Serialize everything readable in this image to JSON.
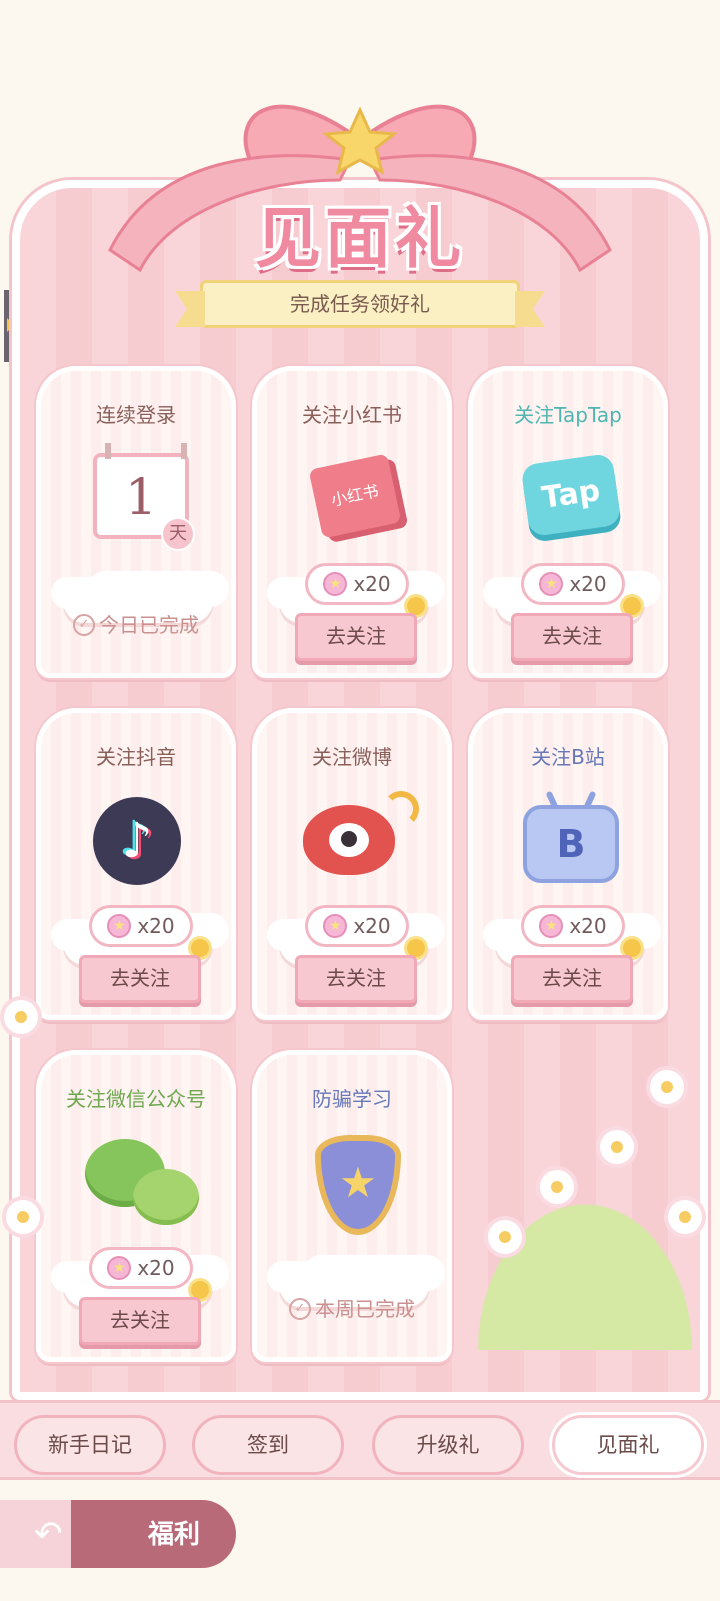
{
  "header": {
    "title": "见面礼",
    "subtitle": "完成任务领好礼"
  },
  "cards": [
    {
      "title": "连续登录",
      "calendar_number": "1",
      "calendar_unit": "天",
      "status": "今日已完成"
    },
    {
      "title": "关注小红书",
      "icon_text": "小红书",
      "reward": "x20",
      "button": "去关注"
    },
    {
      "title": "关注TapTap",
      "icon_text": "Tap",
      "reward": "x20",
      "button": "去关注"
    },
    {
      "title": "关注抖音",
      "icon_text": "♪",
      "reward": "x20",
      "button": "去关注"
    },
    {
      "title": "关注微博",
      "reward": "x20",
      "button": "去关注"
    },
    {
      "title": "关注B站",
      "icon_text": "B",
      "reward": "x20",
      "button": "去关注"
    },
    {
      "title": "关注微信公众号",
      "reward": "x20",
      "button": "去关注"
    },
    {
      "title": "防骗学习",
      "icon_text": "★",
      "status": "本周已完成"
    }
  ],
  "tabs": [
    {
      "label": "新手日记"
    },
    {
      "label": "签到"
    },
    {
      "label": "升级礼"
    },
    {
      "label": "见面礼",
      "active": true
    }
  ],
  "welfare": {
    "label": "福利",
    "back_icon": "back-arrow-icon"
  },
  "colors": {
    "panel": "#f9d5d9",
    "title_pink": "#f08aa0",
    "teal_title": "#4fb6b0",
    "blue_title": "#6777b8",
    "green_title": "#6da84f",
    "button": "#f7c8d0"
  }
}
